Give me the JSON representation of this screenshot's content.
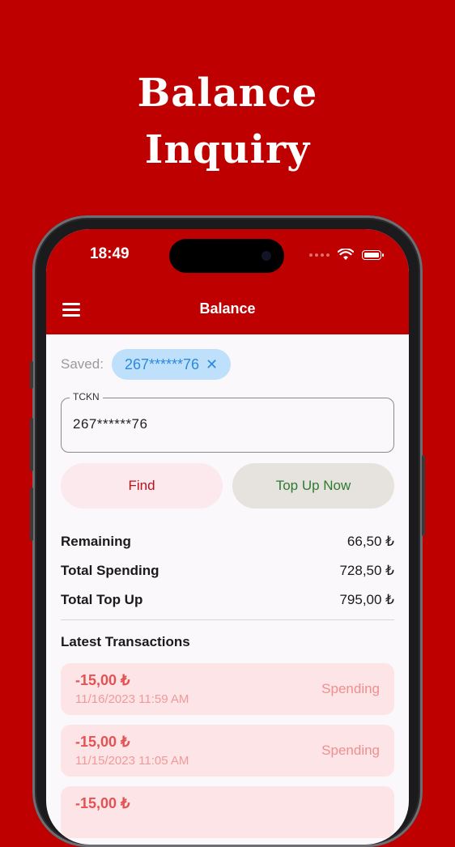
{
  "headline": {
    "line1": "Balance",
    "line2": "Inquiry"
  },
  "status_bar": {
    "time": "18:49",
    "icons": [
      "signal-dots-icon",
      "wifi-icon",
      "battery-icon"
    ]
  },
  "app_bar": {
    "title": "Balance",
    "menu_icon": "hamburger-menu-icon"
  },
  "saved": {
    "label": "Saved:",
    "chip_value": "267******76",
    "chip_close": "✕"
  },
  "tckn_field": {
    "label": "TCKN",
    "value": "267******76"
  },
  "buttons": {
    "find": "Find",
    "top_up": "Top Up Now"
  },
  "stats": [
    {
      "label": "Remaining",
      "value": "66,50 ₺"
    },
    {
      "label": "Total Spending",
      "value": "728,50 ₺"
    },
    {
      "label": "Total Top Up",
      "value": "795,00 ₺"
    }
  ],
  "transactions": {
    "title": "Latest Transactions",
    "items": [
      {
        "amount": "-15,00 ₺",
        "date": "11/16/2023 11:59 AM",
        "type": "Spending"
      },
      {
        "amount": "-15,00 ₺",
        "date": "11/15/2023 11:05 AM",
        "type": "Spending"
      },
      {
        "amount": "-15,00 ₺",
        "date": "",
        "type": ""
      }
    ]
  },
  "colors": {
    "brand_red": "#be0000",
    "chip_blue": "#bfe0fb",
    "spending_bg": "#fde4e6",
    "topup_green": "#2f7a2f"
  }
}
